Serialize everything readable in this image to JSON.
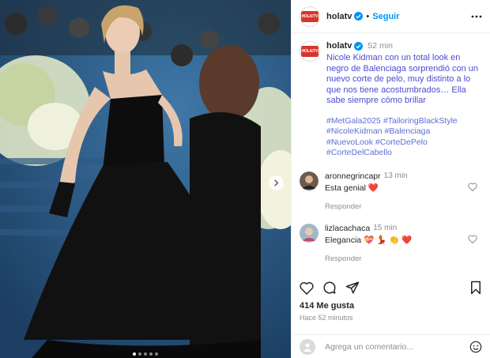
{
  "account": {
    "username": "holatv",
    "logo_text": "HOLA!TV",
    "follow_label": "Seguir",
    "separator": "•"
  },
  "caption": {
    "username": "holatv",
    "time": "52 min",
    "text": "Nicole Kidman con un total look en negro de Balenciaga sorprendió con un nuevo corte de pelo, muy distinto a lo que nos tiene acostumbrados… Ella sabe siempre cómo brillar",
    "hashtags": [
      "#MetGala2025",
      "#TailoringBlackStyle",
      "#NicoleKidman",
      "#Balenciaga",
      "#NuevoLook",
      "#CorteDePelo",
      "#CorteDelCabello"
    ]
  },
  "comments": [
    {
      "username": "aronnegrincapr",
      "time": "13 min",
      "text": "Esta genial ❤️",
      "reply_label": "Responder"
    },
    {
      "username": "lizlacachaca",
      "time": "15 min",
      "text": "Elegancia 💝 💃 👏 ❤️",
      "reply_label": "Responder"
    }
  ],
  "stats": {
    "likes": "414 Me gusta",
    "posted": "Hace 52 minutos"
  },
  "composer": {
    "placeholder": "Agrega un comentario..."
  },
  "icons": {
    "verified": "verified-badge-icon",
    "more": "more-options-icon",
    "like": "heart-icon",
    "comment": "comment-icon",
    "share": "share-icon",
    "save": "bookmark-icon",
    "emoji": "emoji-icon",
    "next": "chevron-right-icon"
  },
  "colors": {
    "accent": "#0095f6",
    "hashtag": "#5b6fd6",
    "brand": "#d9342b",
    "heart": "#ed4956"
  },
  "carousel": {
    "slides": 5,
    "active": 0
  }
}
